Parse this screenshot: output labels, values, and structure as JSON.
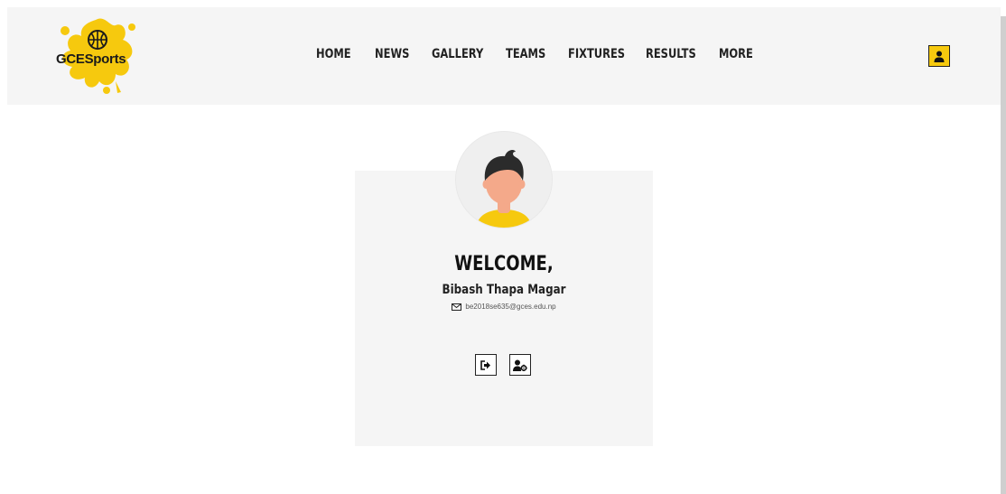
{
  "brand": {
    "name": "GCESports",
    "accent_color": "#f6c90e"
  },
  "nav": {
    "items": [
      {
        "label": "HOME"
      },
      {
        "label": "NEWS"
      },
      {
        "label": "GALLERY"
      },
      {
        "label": "TEAMS"
      },
      {
        "label": "FIXTURES"
      },
      {
        "label": "RESULTS"
      },
      {
        "label": "MORE"
      }
    ]
  },
  "header": {
    "user_icon": "user-icon"
  },
  "profile": {
    "greeting": "WELCOME,",
    "name": "Bibash Thapa Magar",
    "email": "be2018se635@gces.edu.np",
    "email_icon": "envelope-icon",
    "actions": [
      {
        "icon": "sign-out-icon"
      },
      {
        "icon": "user-settings-icon"
      }
    ]
  }
}
